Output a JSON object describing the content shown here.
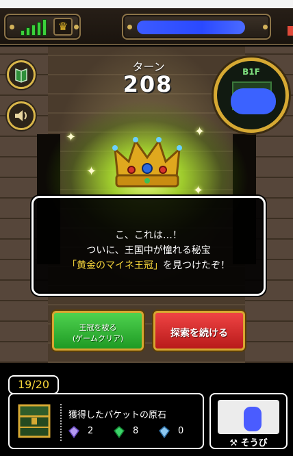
{
  "turn": {
    "label": "ターン",
    "value": "208"
  },
  "minimap": {
    "floor": "B1F"
  },
  "message": {
    "line1": "こ、これは…！",
    "line2": "ついに、王国中が憧れる秘宝",
    "line3_open": "「",
    "line3_item": "黄金のマイネ王冠",
    "line3_close": "」",
    "line3_rest": "を見つけたぞ！"
  },
  "actions": {
    "clear_line1": "王冠を被る",
    "clear_line2": "(ゲームクリア)",
    "continue_label": "探索を続ける"
  },
  "inventory": {
    "capacity": "19/20",
    "title": "獲得したパケットの原石",
    "gems": [
      {
        "icon": "purple-gem-icon",
        "count": "2"
      },
      {
        "icon": "green-gem-icon",
        "count": "8"
      },
      {
        "icon": "blue-gem-icon",
        "count": "0"
      }
    ]
  },
  "equip": {
    "label": "そうび"
  },
  "colors": {
    "accent_gold": "#d7a631",
    "highlight": "#f7d63a",
    "clear_green": "#2aa82e",
    "continue_red": "#d32424"
  }
}
